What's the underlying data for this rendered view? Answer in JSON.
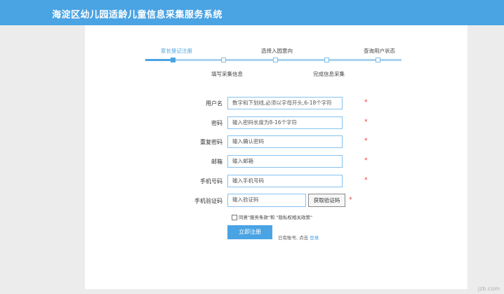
{
  "header": {
    "title": "海淀区幼儿园适龄儿童信息采集服务系统"
  },
  "steps": {
    "top": [
      "家长登记注册",
      "选择入园意向",
      "查询用户状态"
    ],
    "bottom": [
      "填写采集信息",
      "完成信息采集"
    ],
    "current_index": 0
  },
  "form": {
    "username": {
      "label": "用户名",
      "placeholder": "数字和下划线,必须以字母开头,6-18个字符"
    },
    "password": {
      "label": "密码",
      "placeholder": "输入密码长度为8-16个字符"
    },
    "confirm_password": {
      "label": "重复密码",
      "placeholder": "输入确认密码"
    },
    "email": {
      "label": "邮箱",
      "placeholder": "输入邮箱"
    },
    "phone": {
      "label": "手机号码",
      "placeholder": "输入手机号码"
    },
    "sms_code": {
      "label": "手机验证码",
      "placeholder": "输入验证码",
      "button": "获取验证码"
    },
    "required_mark": "*"
  },
  "agreement": {
    "text": "同意\"服务条款\"和 \"隐私权相关政策\"",
    "checked": false
  },
  "submit": {
    "label": "立即注册"
  },
  "login_hint": {
    "text": "已有账号, 点击",
    "link": "登录"
  },
  "watermark": "jzb.com",
  "colors": {
    "accent": "#4aa3e3",
    "required": "#e53935",
    "header": "#4aa3e3"
  }
}
